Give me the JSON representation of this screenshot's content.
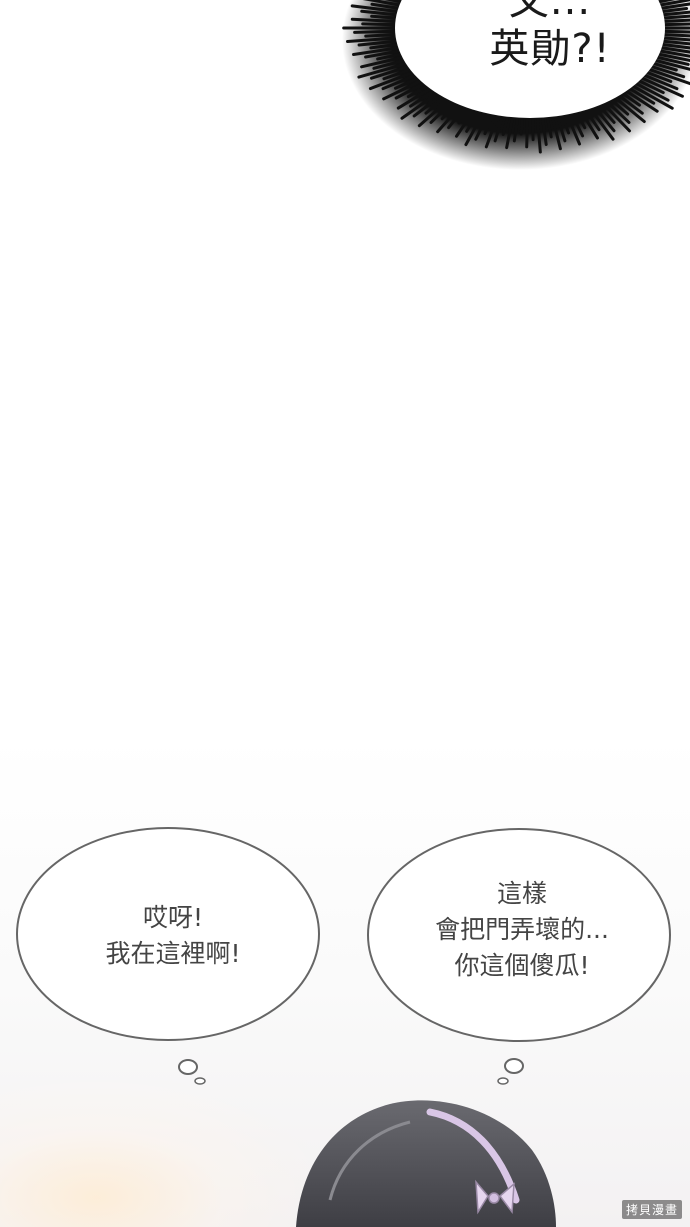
{
  "panel_top": {
    "shout_line1": "文...",
    "shout_line2": "英勛?!"
  },
  "bubble_left": {
    "line1": "哎呀!",
    "line2": "我在這裡啊!"
  },
  "bubble_right": {
    "line1": "這樣",
    "line2": "會把門弄壞的...",
    "line3": "你這個傻瓜!"
  },
  "watermark": "拷貝漫畫",
  "colors": {
    "background": "#ffffff",
    "spike_bubble": "#111111",
    "thought_bubble_outline": "#666666",
    "text_dark": "#1a1a1a",
    "text_bubble": "#444444",
    "hair": "#4a4a4e",
    "headband": "#d9c6e6"
  }
}
